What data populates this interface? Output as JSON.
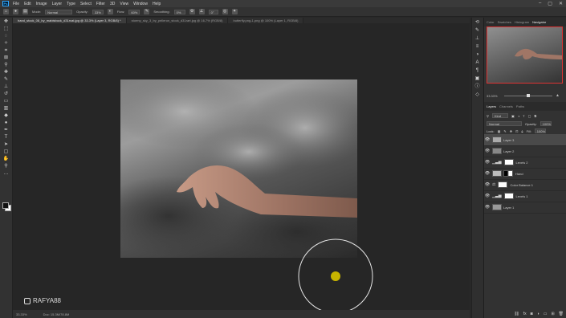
{
  "menu": {
    "app_logo": "Ps",
    "items": [
      "File",
      "Edit",
      "Image",
      "Layer",
      "Type",
      "Select",
      "Filter",
      "3D",
      "View",
      "Window",
      "Help"
    ],
    "window_controls": [
      "–",
      "▢",
      "✕"
    ]
  },
  "options": {
    "mode_label": "Mode:",
    "mode_value": "Normal",
    "opacity_label": "Opacity:",
    "opacity_value": "33%",
    "flow_label": "Flow:",
    "flow_value": "60%",
    "smoothing_label": "Smoothing:",
    "smoothing_value": "0%",
    "angle_value": "0°"
  },
  "tabs": [
    {
      "label": "hand_stock_08_by_mabisbock_d31rxat.jpg @ 33.3% (Layer 3, RGB/8) *",
      "active": true
    },
    {
      "label": "stormy_sky_3_by_pelleron_stock_d31rart.jpg @ 16.7% (RGB/8)",
      "active": false
    },
    {
      "label": "butterfly.png-1.png @ 100% (Layer 1, RGB/8)",
      "active": false
    }
  ],
  "status": {
    "zoom": "33.33%",
    "doc": "Doc: 15.3M/78.8M"
  },
  "watermark": "RAFYA88",
  "navigator": {
    "tabs": [
      "Color",
      "Swatches",
      "Histogram",
      "Navigator"
    ],
    "active_tab": "Navigator",
    "zoom": "33.33%"
  },
  "layers_panel": {
    "tabs": [
      "Layers",
      "Channels",
      "Paths"
    ],
    "active_tab": "Layers",
    "kind_label": "Kind",
    "blend_mode": "Normal",
    "opacity_label": "Opacity:",
    "opacity_value": "100%",
    "lock_label": "Lock:",
    "fill_label": "Fill:",
    "fill_value": "100%",
    "layers": [
      {
        "name": "Layer 3",
        "selected": true,
        "mask": false
      },
      {
        "name": "Layer 2",
        "selected": false,
        "mask": false
      },
      {
        "name": "Levels 2",
        "selected": false,
        "mask": true
      },
      {
        "name": "Hand",
        "selected": false,
        "mask": true
      },
      {
        "name": "Color Balance 1",
        "selected": false,
        "mask": true
      },
      {
        "name": "Levels 1",
        "selected": false,
        "mask": true
      },
      {
        "name": "Layer 1",
        "selected": false,
        "mask": false
      }
    ]
  },
  "colors": {
    "brush_cursor": "#c8b400",
    "navigator_frame": "#dd3333"
  }
}
